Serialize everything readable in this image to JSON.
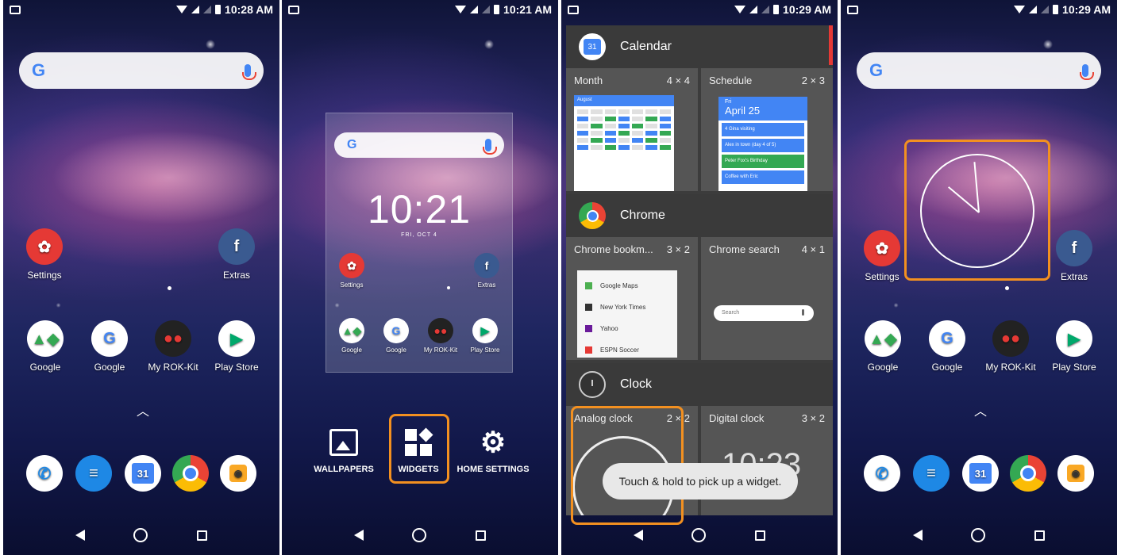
{
  "status": {
    "times": [
      "10:28 AM",
      "10:21 AM",
      "10:29 AM",
      "10:29 AM"
    ]
  },
  "search": {
    "logo": "G"
  },
  "home": {
    "settings_label": "Settings",
    "extras_label": "Extras",
    "apps": [
      "Google",
      "Google",
      "My ROK-Kit",
      "Play Store"
    ]
  },
  "preview": {
    "time": "10:21",
    "date": "FRI, OCT 4"
  },
  "menu": {
    "wallpapers": "WALLPAPERS",
    "widgets": "WIDGETS",
    "home_settings": "HOME SETTINGS"
  },
  "widgets": {
    "calendar": {
      "app": "Calendar",
      "items": [
        {
          "name": "Month",
          "size": "4 × 4"
        },
        {
          "name": "Schedule",
          "size": "2 × 3"
        }
      ],
      "month_header": "August",
      "schedule": {
        "day": "Fri",
        "date": "April 25",
        "events": [
          "4 Gina visiting",
          "Alex in town (day 4 of 5)",
          "Peter Fox's Birthday",
          "Coffee with Eric"
        ]
      }
    },
    "chrome": {
      "app": "Chrome",
      "items": [
        {
          "name": "Chrome bookm...",
          "size": "3 × 2"
        },
        {
          "name": "Chrome search",
          "size": "4 × 1"
        }
      ],
      "bookmarks": [
        "Google Maps",
        "New York Times",
        "Yahoo",
        "ESPN Soccer"
      ],
      "search_placeholder": "Search"
    },
    "clock": {
      "app": "Clock",
      "items": [
        {
          "name": "Analog clock",
          "size": "2 × 2"
        },
        {
          "name": "Digital clock",
          "size": "3 × 2"
        }
      ],
      "digital_time": "10:23"
    },
    "toast": "Touch & hold to pick up a widget."
  },
  "colors": {
    "highlight": "#f39020",
    "accent": "#4285f4"
  }
}
